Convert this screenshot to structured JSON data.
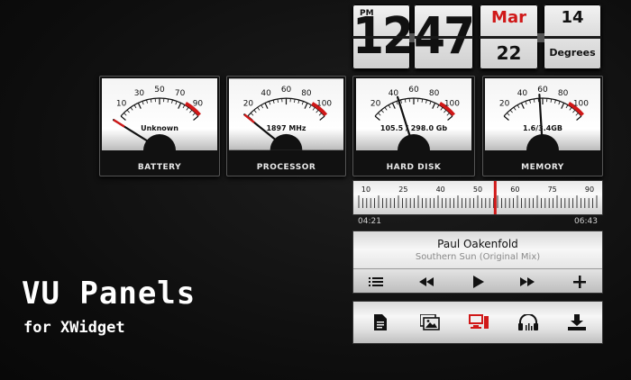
{
  "clock": {
    "ampm": "PM",
    "hour": "12",
    "minute": "47"
  },
  "calendar": {
    "month": "Mar",
    "day": "22",
    "month_color": "#d01818"
  },
  "weather": {
    "value": "14",
    "unit": "Degrees"
  },
  "meters": [
    {
      "id": "battery",
      "label": "BATTERY",
      "readout": "Unknown",
      "ticks": [
        "10",
        "30",
        "50",
        "70",
        "90"
      ],
      "needle_fraction": 0.0
    },
    {
      "id": "processor",
      "label": "PROCESSOR",
      "readout": "1897 MHz",
      "ticks": [
        "20",
        "40",
        "60",
        "80",
        "100"
      ],
      "needle_fraction": 0.06
    },
    {
      "id": "harddisk",
      "label": "HARD DISK",
      "readout": "105.5 / 298.0 Gb",
      "ticks": [
        "20",
        "40",
        "60",
        "80",
        "100"
      ],
      "needle_fraction": 0.35
    },
    {
      "id": "memory",
      "label": "MEMORY",
      "readout": "1.6/3.4GB",
      "ticks": [
        "20",
        "40",
        "60",
        "80",
        "100"
      ],
      "needle_fraction": 0.47
    }
  ],
  "tuner": {
    "ticks": [
      "10",
      "25",
      "40",
      "50",
      "60",
      "75",
      "90"
    ],
    "position_fraction": 0.57,
    "elapsed": "04:21",
    "total": "06:43",
    "marker_color": "#d01818"
  },
  "player": {
    "artist": "Paul Oakenfold",
    "track": "Southern Sun (Original Mix)"
  },
  "player_controls": [
    "playlist-icon",
    "rewind-icon",
    "play-icon",
    "fast-forward-icon",
    "add-icon"
  ],
  "launcher": [
    "document-icon",
    "pictures-icon",
    "computer-icon",
    "music-icon",
    "download-icon"
  ],
  "branding": {
    "title": "VU Panels",
    "subtitle": "for XWidget"
  }
}
